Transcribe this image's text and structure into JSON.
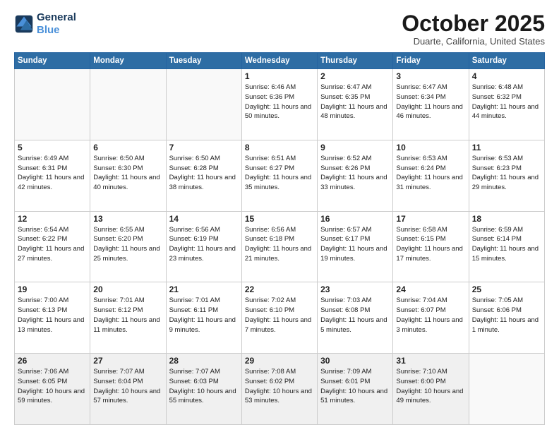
{
  "header": {
    "logo_line1": "General",
    "logo_line2": "Blue",
    "month": "October 2025",
    "location": "Duarte, California, United States"
  },
  "weekdays": [
    "Sunday",
    "Monday",
    "Tuesday",
    "Wednesday",
    "Thursday",
    "Friday",
    "Saturday"
  ],
  "weeks": [
    [
      {
        "day": "",
        "sunrise": "",
        "sunset": "",
        "daylight": ""
      },
      {
        "day": "",
        "sunrise": "",
        "sunset": "",
        "daylight": ""
      },
      {
        "day": "",
        "sunrise": "",
        "sunset": "",
        "daylight": ""
      },
      {
        "day": "1",
        "sunrise": "Sunrise: 6:46 AM",
        "sunset": "Sunset: 6:36 PM",
        "daylight": "Daylight: 11 hours and 50 minutes."
      },
      {
        "day": "2",
        "sunrise": "Sunrise: 6:47 AM",
        "sunset": "Sunset: 6:35 PM",
        "daylight": "Daylight: 11 hours and 48 minutes."
      },
      {
        "day": "3",
        "sunrise": "Sunrise: 6:47 AM",
        "sunset": "Sunset: 6:34 PM",
        "daylight": "Daylight: 11 hours and 46 minutes."
      },
      {
        "day": "4",
        "sunrise": "Sunrise: 6:48 AM",
        "sunset": "Sunset: 6:32 PM",
        "daylight": "Daylight: 11 hours and 44 minutes."
      }
    ],
    [
      {
        "day": "5",
        "sunrise": "Sunrise: 6:49 AM",
        "sunset": "Sunset: 6:31 PM",
        "daylight": "Daylight: 11 hours and 42 minutes."
      },
      {
        "day": "6",
        "sunrise": "Sunrise: 6:50 AM",
        "sunset": "Sunset: 6:30 PM",
        "daylight": "Daylight: 11 hours and 40 minutes."
      },
      {
        "day": "7",
        "sunrise": "Sunrise: 6:50 AM",
        "sunset": "Sunset: 6:28 PM",
        "daylight": "Daylight: 11 hours and 38 minutes."
      },
      {
        "day": "8",
        "sunrise": "Sunrise: 6:51 AM",
        "sunset": "Sunset: 6:27 PM",
        "daylight": "Daylight: 11 hours and 35 minutes."
      },
      {
        "day": "9",
        "sunrise": "Sunrise: 6:52 AM",
        "sunset": "Sunset: 6:26 PM",
        "daylight": "Daylight: 11 hours and 33 minutes."
      },
      {
        "day": "10",
        "sunrise": "Sunrise: 6:53 AM",
        "sunset": "Sunset: 6:24 PM",
        "daylight": "Daylight: 11 hours and 31 minutes."
      },
      {
        "day": "11",
        "sunrise": "Sunrise: 6:53 AM",
        "sunset": "Sunset: 6:23 PM",
        "daylight": "Daylight: 11 hours and 29 minutes."
      }
    ],
    [
      {
        "day": "12",
        "sunrise": "Sunrise: 6:54 AM",
        "sunset": "Sunset: 6:22 PM",
        "daylight": "Daylight: 11 hours and 27 minutes."
      },
      {
        "day": "13",
        "sunrise": "Sunrise: 6:55 AM",
        "sunset": "Sunset: 6:20 PM",
        "daylight": "Daylight: 11 hours and 25 minutes."
      },
      {
        "day": "14",
        "sunrise": "Sunrise: 6:56 AM",
        "sunset": "Sunset: 6:19 PM",
        "daylight": "Daylight: 11 hours and 23 minutes."
      },
      {
        "day": "15",
        "sunrise": "Sunrise: 6:56 AM",
        "sunset": "Sunset: 6:18 PM",
        "daylight": "Daylight: 11 hours and 21 minutes."
      },
      {
        "day": "16",
        "sunrise": "Sunrise: 6:57 AM",
        "sunset": "Sunset: 6:17 PM",
        "daylight": "Daylight: 11 hours and 19 minutes."
      },
      {
        "day": "17",
        "sunrise": "Sunrise: 6:58 AM",
        "sunset": "Sunset: 6:15 PM",
        "daylight": "Daylight: 11 hours and 17 minutes."
      },
      {
        "day": "18",
        "sunrise": "Sunrise: 6:59 AM",
        "sunset": "Sunset: 6:14 PM",
        "daylight": "Daylight: 11 hours and 15 minutes."
      }
    ],
    [
      {
        "day": "19",
        "sunrise": "Sunrise: 7:00 AM",
        "sunset": "Sunset: 6:13 PM",
        "daylight": "Daylight: 11 hours and 13 minutes."
      },
      {
        "day": "20",
        "sunrise": "Sunrise: 7:01 AM",
        "sunset": "Sunset: 6:12 PM",
        "daylight": "Daylight: 11 hours and 11 minutes."
      },
      {
        "day": "21",
        "sunrise": "Sunrise: 7:01 AM",
        "sunset": "Sunset: 6:11 PM",
        "daylight": "Daylight: 11 hours and 9 minutes."
      },
      {
        "day": "22",
        "sunrise": "Sunrise: 7:02 AM",
        "sunset": "Sunset: 6:10 PM",
        "daylight": "Daylight: 11 hours and 7 minutes."
      },
      {
        "day": "23",
        "sunrise": "Sunrise: 7:03 AM",
        "sunset": "Sunset: 6:08 PM",
        "daylight": "Daylight: 11 hours and 5 minutes."
      },
      {
        "day": "24",
        "sunrise": "Sunrise: 7:04 AM",
        "sunset": "Sunset: 6:07 PM",
        "daylight": "Daylight: 11 hours and 3 minutes."
      },
      {
        "day": "25",
        "sunrise": "Sunrise: 7:05 AM",
        "sunset": "Sunset: 6:06 PM",
        "daylight": "Daylight: 11 hours and 1 minute."
      }
    ],
    [
      {
        "day": "26",
        "sunrise": "Sunrise: 7:06 AM",
        "sunset": "Sunset: 6:05 PM",
        "daylight": "Daylight: 10 hours and 59 minutes."
      },
      {
        "day": "27",
        "sunrise": "Sunrise: 7:07 AM",
        "sunset": "Sunset: 6:04 PM",
        "daylight": "Daylight: 10 hours and 57 minutes."
      },
      {
        "day": "28",
        "sunrise": "Sunrise: 7:07 AM",
        "sunset": "Sunset: 6:03 PM",
        "daylight": "Daylight: 10 hours and 55 minutes."
      },
      {
        "day": "29",
        "sunrise": "Sunrise: 7:08 AM",
        "sunset": "Sunset: 6:02 PM",
        "daylight": "Daylight: 10 hours and 53 minutes."
      },
      {
        "day": "30",
        "sunrise": "Sunrise: 7:09 AM",
        "sunset": "Sunset: 6:01 PM",
        "daylight": "Daylight: 10 hours and 51 minutes."
      },
      {
        "day": "31",
        "sunrise": "Sunrise: 7:10 AM",
        "sunset": "Sunset: 6:00 PM",
        "daylight": "Daylight: 10 hours and 49 minutes."
      },
      {
        "day": "",
        "sunrise": "",
        "sunset": "",
        "daylight": ""
      }
    ]
  ]
}
